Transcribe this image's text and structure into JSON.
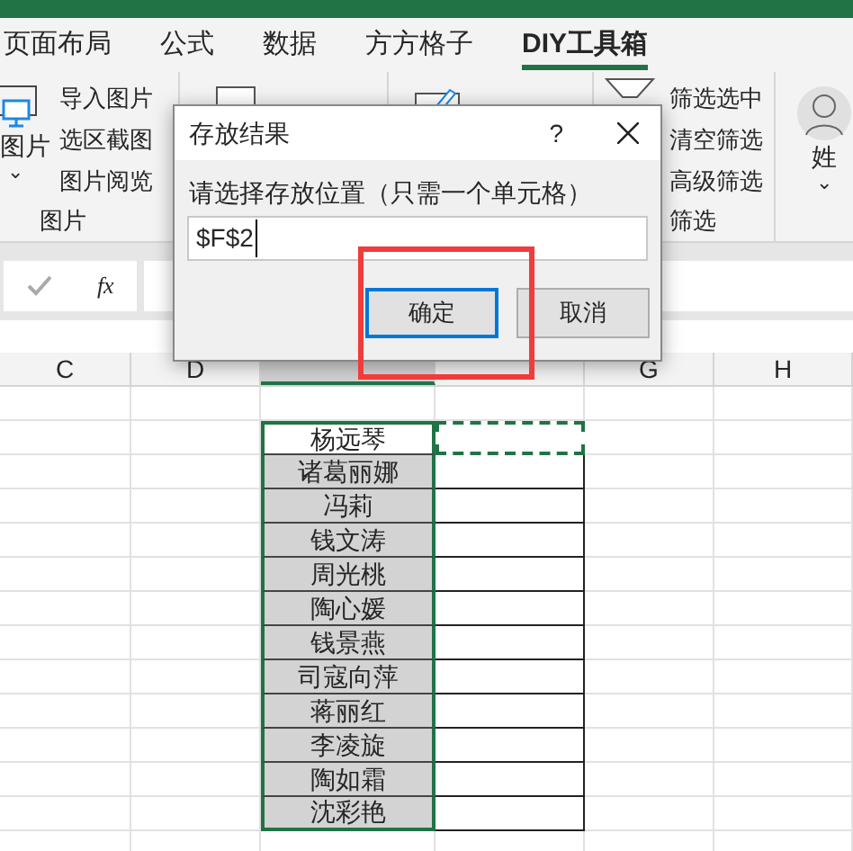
{
  "tabs": [
    {
      "label": "页面布局",
      "selected": false
    },
    {
      "label": "公式",
      "selected": false
    },
    {
      "label": "数据",
      "selected": false
    },
    {
      "label": "方方格子",
      "selected": false
    },
    {
      "label": "DIY工具箱",
      "selected": true
    }
  ],
  "ribbon": {
    "big_button": {
      "label": "图片",
      "caret": "⌄"
    },
    "image_items": [
      "导入图片",
      "选区截图",
      "图片阅览"
    ],
    "image_group": "图片",
    "filter_items": [
      "筛选选中",
      "清空筛选",
      "高级筛选"
    ],
    "filter_group": "筛选",
    "right_button": {
      "label": "姓",
      "caret": "⌄"
    }
  },
  "formula_bar": {
    "fx": "fx"
  },
  "columns": [
    {
      "label": "C",
      "selected": false
    },
    {
      "label": "D",
      "selected": false
    },
    {
      "selected": true
    },
    {
      "selected": false
    },
    {
      "label": "G",
      "selected": false
    },
    {
      "label": "H",
      "selected": false
    }
  ],
  "names": [
    "杨远琴",
    "诸葛丽娜",
    "冯莉",
    "钱文涛",
    "周光桃",
    "陶心媛",
    "钱景燕",
    "司寇向萍",
    "蒋丽红",
    "李凌旋",
    "陶如霜",
    "沈彩艳"
  ],
  "dialog": {
    "title": "存放结果",
    "help": "?",
    "prompt": "请选择存放位置（只需一个单元格）",
    "value": "$F$2",
    "ok": "确定",
    "cancel": "取消"
  }
}
